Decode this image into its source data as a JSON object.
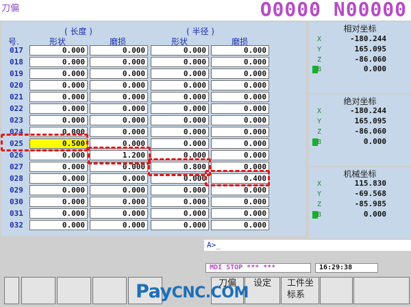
{
  "header": {
    "screen_title": "刀偏",
    "program_number": "O0000 N00000"
  },
  "offset_table": {
    "group_length": "( 长度 )",
    "group_radius": "( 半径 )",
    "col_no": "号.",
    "col_length_shape": "形状",
    "col_length_wear": "磨损",
    "col_radius_shape": "形状",
    "col_radius_wear": "磨损",
    "rows": [
      {
        "no": "017",
        "ls": "0.000",
        "lw": "0.000",
        "rs": "0.000",
        "rw": "0.000"
      },
      {
        "no": "018",
        "ls": "0.000",
        "lw": "0.000",
        "rs": "0.000",
        "rw": "0.000"
      },
      {
        "no": "019",
        "ls": "0.000",
        "lw": "0.000",
        "rs": "0.000",
        "rw": "0.000"
      },
      {
        "no": "020",
        "ls": "0.000",
        "lw": "0.000",
        "rs": "0.000",
        "rw": "0.000"
      },
      {
        "no": "021",
        "ls": "0.000",
        "lw": "0.000",
        "rs": "0.000",
        "rw": "0.000"
      },
      {
        "no": "022",
        "ls": "0.000",
        "lw": "0.000",
        "rs": "0.000",
        "rw": "0.000"
      },
      {
        "no": "023",
        "ls": "0.000",
        "lw": "0.000",
        "rs": "0.000",
        "rw": "0.000"
      },
      {
        "no": "024",
        "ls": "0.000",
        "lw": "0.000",
        "rs": "0.000",
        "rw": "0.000"
      },
      {
        "no": "025",
        "ls": "0.500",
        "lw": "0.000",
        "rs": "0.000",
        "rw": "0.000"
      },
      {
        "no": "026",
        "ls": "0.000",
        "lw": "1.200",
        "rs": "0.000",
        "rw": "0.000"
      },
      {
        "no": "027",
        "ls": "0.000",
        "lw": "0.000",
        "rs": "0.800",
        "rw": "0.000"
      },
      {
        "no": "028",
        "ls": "0.000",
        "lw": "0.000",
        "rs": "0.000",
        "rw": "0.400"
      },
      {
        "no": "029",
        "ls": "0.000",
        "lw": "0.000",
        "rs": "0.000",
        "rw": "0.000"
      },
      {
        "no": "030",
        "ls": "0.000",
        "lw": "0.000",
        "rs": "0.000",
        "rw": "0.000"
      },
      {
        "no": "031",
        "ls": "0.000",
        "lw": "0.000",
        "rs": "0.000",
        "rw": "0.000"
      },
      {
        "no": "032",
        "ls": "0.000",
        "lw": "0.000",
        "rs": "0.000",
        "rw": "0.000"
      }
    ],
    "selected_row": "025",
    "highlight_color": "#ffff00"
  },
  "coordinates": {
    "relative": {
      "title": "相对坐标",
      "x": "-180.244",
      "y": "165.095",
      "z": "-86.060",
      "b": "0.000"
    },
    "absolute": {
      "title": "绝对坐标",
      "x": "-180.244",
      "y": "165.095",
      "z": "-86.060",
      "b": "0.000"
    },
    "machine": {
      "title": "机械坐标",
      "x": "115.830",
      "y": "-69.568",
      "z": "-85.985",
      "b": "0.000"
    },
    "axis_labels": {
      "x": "X",
      "y": "Y",
      "z": "Z",
      "b": "B"
    }
  },
  "input": {
    "prompt": "A>_"
  },
  "status": {
    "mode": "MDI  STOP *** ***",
    "time": "16:29:38"
  },
  "softkeys": [
    {
      "label": ""
    },
    {
      "label": ""
    },
    {
      "label": ""
    },
    {
      "label": ""
    },
    {
      "label": ""
    },
    {
      "label": "刀偏"
    },
    {
      "label": "设定"
    },
    {
      "label": "工件坐标系"
    },
    {
      "label": ""
    },
    {
      "label": ""
    }
  ],
  "watermark": {
    "pay": "Pay",
    "cnc": "CNC.COM"
  },
  "colors": {
    "accent": "#b64cc4",
    "annotation": "#e01818",
    "panel": "#c7d7ea",
    "header_text": "#1c2fa8"
  }
}
